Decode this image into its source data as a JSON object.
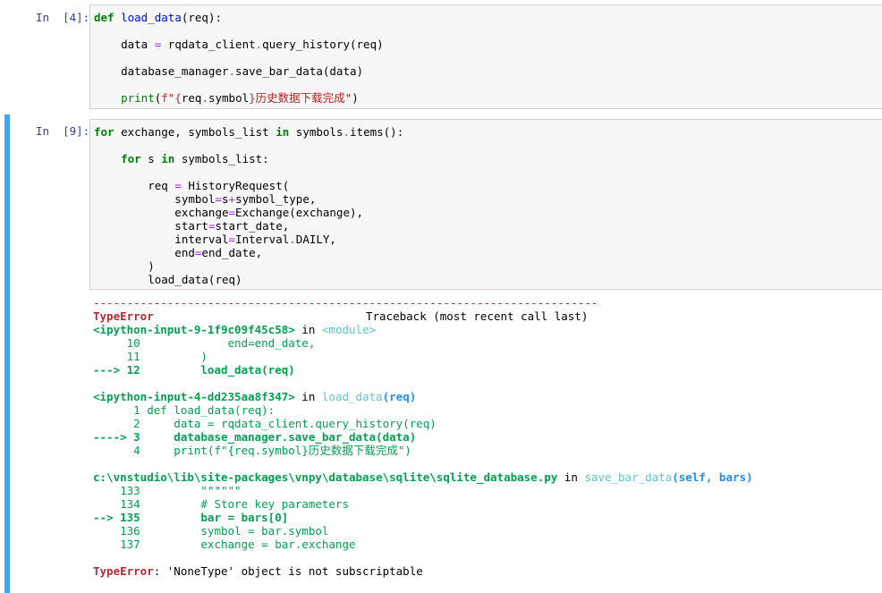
{
  "cell1": {
    "prompt": "In  [4]:",
    "lines": [
      "def load_data(req):",
      "    data = rqdata_client.query_history(req)",
      "    database_manager.save_bar_data(data)",
      "    print(f\"{req.symbol}历史数据下载完成\")"
    ]
  },
  "cell2": {
    "prompt": "In  [9]:",
    "lines": [
      "for exchange, symbols_list in symbols.items():",
      "    for s in symbols_list:",
      "        req = HistoryRequest(",
      "            symbol=s+symbol_type,",
      "            exchange=Exchange(exchange),",
      "            start=start_date,",
      "            interval=Interval.DAILY,",
      "            end=end_date,",
      "        )",
      "        load_data(req)"
    ]
  },
  "traceback": {
    "dashes": "---------------------------------------------------------------------------",
    "error_type": "TypeError",
    "header_right": "Traceback (most recent call last)",
    "frame1": {
      "location": "<ipython-input-9-1f9c09f45c58>",
      "in": " in ",
      "func": "<module>",
      "lines": [
        "     10             end=end_date,",
        "     11         )",
        "---> 12         load_data(req)"
      ]
    },
    "frame2": {
      "location": "<ipython-input-4-dd235aa8f347>",
      "in": " in ",
      "func": "load_data",
      "args": "(req)",
      "lines": [
        "      1 def load_data(req):",
        "      2     data = rqdata_client.query_history(req)",
        "----> 3     database_manager.save_bar_data(data)",
        "      4     print(f\"{req.symbol}历史数据下载完成\")"
      ]
    },
    "frame3": {
      "location": "c:\\vnstudio\\lib\\site-packages\\vnpy\\database\\sqlite\\sqlite_database.py",
      "in": " in ",
      "func": "save_bar_data",
      "args": "(self, bars)",
      "lines": [
        "    133         \"\"\"\"\"\"",
        "    134         # Store key parameters",
        "--> 135         bar = bars[0]",
        "    136         symbol = bar.symbol",
        "    137         exchange = bar.exchange"
      ]
    },
    "final_type": "TypeError",
    "final_message": ": 'NoneType' object is not subscriptable"
  }
}
